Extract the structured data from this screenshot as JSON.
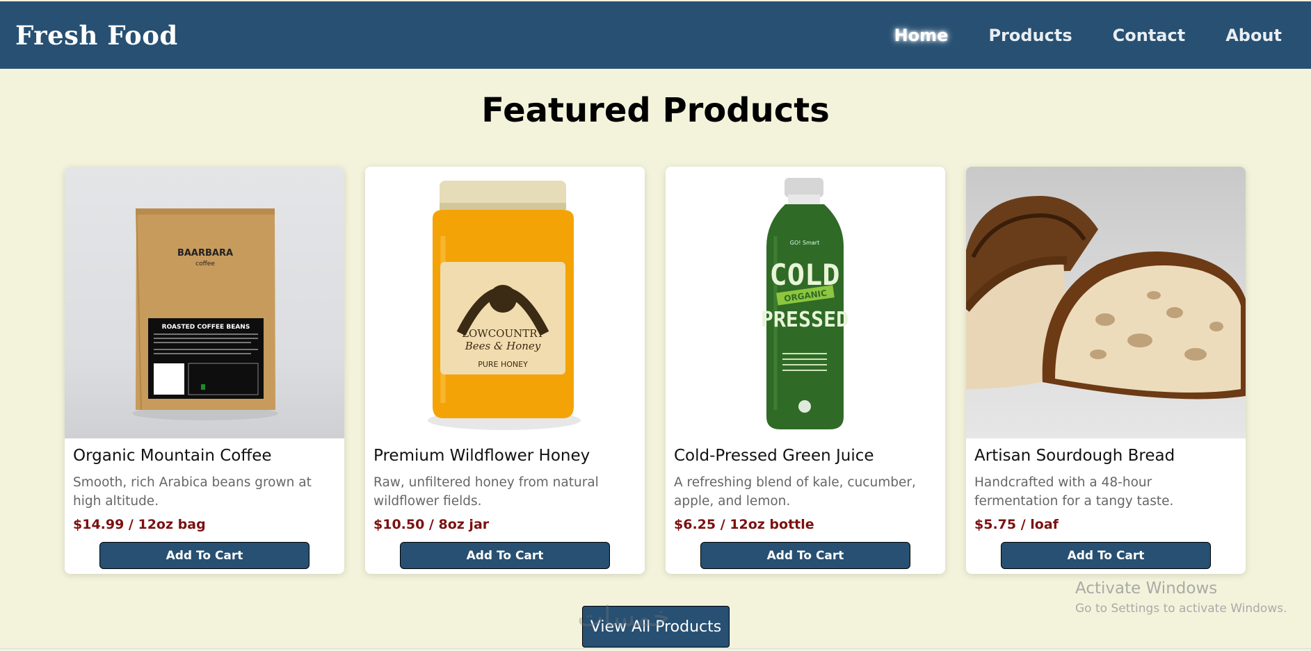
{
  "navbar": {
    "brand": "Fresh Food",
    "links": [
      {
        "label": "Home",
        "active": true
      },
      {
        "label": "Products",
        "active": false
      },
      {
        "label": "Contact",
        "active": false
      },
      {
        "label": "About",
        "active": false
      }
    ]
  },
  "page_title": "Featured Products",
  "products": [
    {
      "title": "Organic Mountain Coffee",
      "description": "Smooth, rich Arabica beans grown at high altitude.",
      "price": "$14.99 / 12oz bag",
      "button": "Add To Cart",
      "image_icon": "coffee-bag",
      "image_text": {
        "brand": "BAARBARA",
        "sub": "coffee",
        "label": "ROASTED COFFEE BEANS"
      }
    },
    {
      "title": "Premium Wildflower Honey",
      "description": "Raw, unfiltered honey from natural wildflower fields.",
      "price": "$10.50 / 8oz jar",
      "button": "Add To Cart",
      "image_icon": "honey-jar",
      "image_text": {
        "brand": "LOWCOUNTRY",
        "sub": "Bees & Honey",
        "label": "PURE HONEY"
      }
    },
    {
      "title": "Cold-Pressed Green Juice",
      "description": "A refreshing blend of kale, cucumber, apple, and lemon.",
      "price": "$6.25 / 12oz bottle",
      "button": "Add To Cart",
      "image_icon": "juice-bottle",
      "image_text": {
        "brand": "COLD",
        "sub": "ORGANIC",
        "label": "PRESSED"
      }
    },
    {
      "title": "Artisan Sourdough Bread",
      "description": "Handcrafted with a 48-hour fermentation for a tangy taste.",
      "price": "$5.75 / loaf",
      "button": "Add To Cart",
      "image_icon": "bread-loaf"
    }
  ],
  "view_all_button": "View All Products",
  "watermark": "خمسات",
  "os_overlay": {
    "line1": "Activate Windows",
    "line2": "Go to Settings to activate Windows."
  },
  "colors": {
    "navbar": "#275072",
    "background": "#f3f3dc",
    "price": "#7b1010",
    "button": "#275072"
  }
}
